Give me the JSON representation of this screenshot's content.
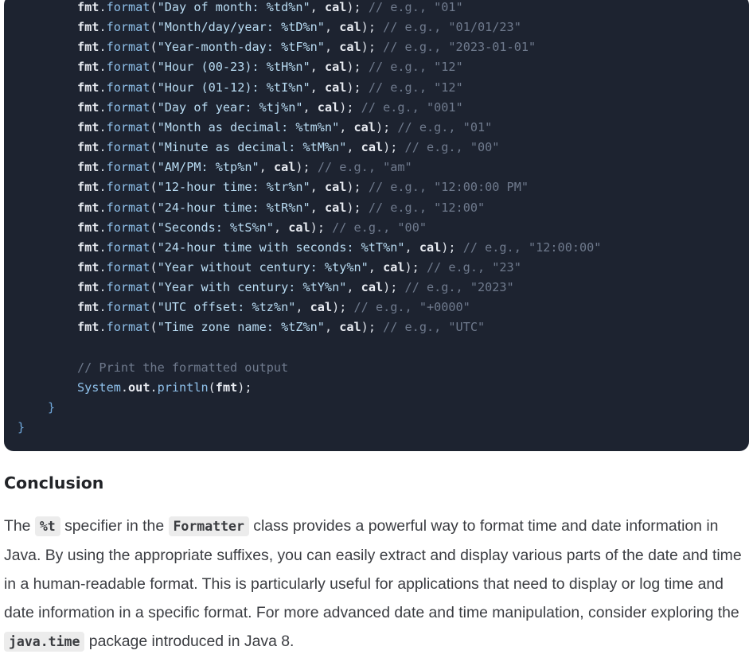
{
  "code": {
    "format_lines": [
      {
        "str": "\"Day of month: %td%n\"",
        "cmt": "// e.g., \"01\""
      },
      {
        "str": "\"Month/day/year: %tD%n\"",
        "cmt": "// e.g., \"01/01/23\""
      },
      {
        "str": "\"Year-month-day: %tF%n\"",
        "cmt": "// e.g., \"2023-01-01\""
      },
      {
        "str": "\"Hour (00-23): %tH%n\"",
        "cmt": "// e.g., \"12\""
      },
      {
        "str": "\"Hour (01-12): %tI%n\"",
        "cmt": "// e.g., \"12\""
      },
      {
        "str": "\"Day of year: %tj%n\"",
        "cmt": "// e.g., \"001\""
      },
      {
        "str": "\"Month as decimal: %tm%n\"",
        "cmt": "// e.g., \"01\""
      },
      {
        "str": "\"Minute as decimal: %tM%n\"",
        "cmt": "// e.g., \"00\""
      },
      {
        "str": "\"AM/PM: %tp%n\"",
        "cmt": "// e.g., \"am\""
      },
      {
        "str": "\"12-hour time: %tr%n\"",
        "cmt": "// e.g., \"12:00:00 PM\""
      },
      {
        "str": "\"24-hour time: %tR%n\"",
        "cmt": "// e.g., \"12:00\""
      },
      {
        "str": "\"Seconds: %tS%n\"",
        "cmt": "// e.g., \"00\""
      },
      {
        "str": "\"24-hour time with seconds: %tT%n\"",
        "cmt": "// e.g., \"12:00:00\""
      },
      {
        "str": "\"Year without century: %ty%n\"",
        "cmt": "// e.g., \"23\""
      },
      {
        "str": "\"Year with century: %tY%n\"",
        "cmt": "// e.g., \"2023\""
      },
      {
        "str": "\"UTC offset: %tz%n\"",
        "cmt": "// e.g., \"+0000\""
      },
      {
        "str": "\"Time zone name: %tZ%n\"",
        "cmt": "// e.g., \"UTC\""
      }
    ],
    "tokens": {
      "fmt": "fmt",
      "format": "format",
      "cal": "cal",
      "system": "System",
      "out": "out",
      "println": "println"
    },
    "print_comment": "// Print the formatted output",
    "inner_close": "}",
    "outer_close": "}"
  },
  "conclusion": {
    "heading": "Conclusion",
    "p1": "The ",
    "code1": "%t",
    "p2": " specifier in the ",
    "code2": "Formatter",
    "p3": " class provides a powerful way to format time and date information in Java. By using the appropriate suffixes, you can easily extract and display various parts of the date and time in a human-readable format. This is particularly useful for applications that need to display or log time and date information in a specific format. For more advanced date and time manipulation, consider exploring the ",
    "code3": "java.time",
    "p4": " package introduced in Java 8."
  }
}
